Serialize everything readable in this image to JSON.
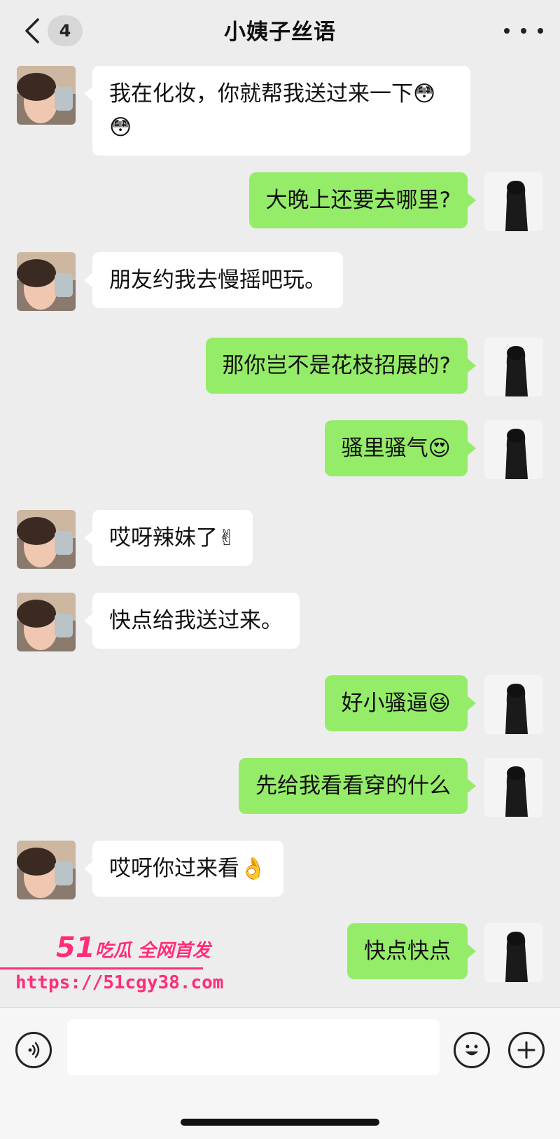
{
  "header": {
    "back_label": "<",
    "unread_count": "4",
    "title": "小姨子丝语",
    "more_label": "···"
  },
  "messages": [
    {
      "side": "left",
      "text": "我在化妆，你就帮我送过来一下",
      "emoji": "😳😳"
    },
    {
      "side": "right",
      "text": "大晚上还要去哪里?",
      "emoji": ""
    },
    {
      "side": "left",
      "text": "朋友约我去慢摇吧玩。",
      "emoji": ""
    },
    {
      "side": "right",
      "text": "那你岂不是花枝招展的?",
      "emoji": ""
    },
    {
      "side": "right",
      "text": "骚里骚气",
      "emoji": "😍"
    },
    {
      "side": "left",
      "text": "哎呀辣妹了",
      "emoji": "✌"
    },
    {
      "side": "left",
      "text": "快点给我送过来。",
      "emoji": ""
    },
    {
      "side": "right",
      "text": "好小骚逼",
      "emoji": "😆"
    },
    {
      "side": "right",
      "text": "先给我看看穿的什么",
      "emoji": ""
    },
    {
      "side": "left",
      "text": "哎呀你过来看",
      "emoji": "👌"
    },
    {
      "side": "right",
      "text": "快点快点",
      "emoji": ""
    }
  ],
  "watermark": {
    "brand": "51",
    "slogan": "吃瓜 全网首发",
    "url": "https://51cgy38.com"
  },
  "input_bar": {
    "placeholder": "",
    "voice_icon": "voice-icon",
    "emoji_icon": "emoji-icon",
    "plus_icon": "plus-icon"
  },
  "colors": {
    "background": "#ededed",
    "sent_bubble": "#95ec69",
    "received_bubble": "#ffffff",
    "watermark": "#ff2d7a"
  }
}
